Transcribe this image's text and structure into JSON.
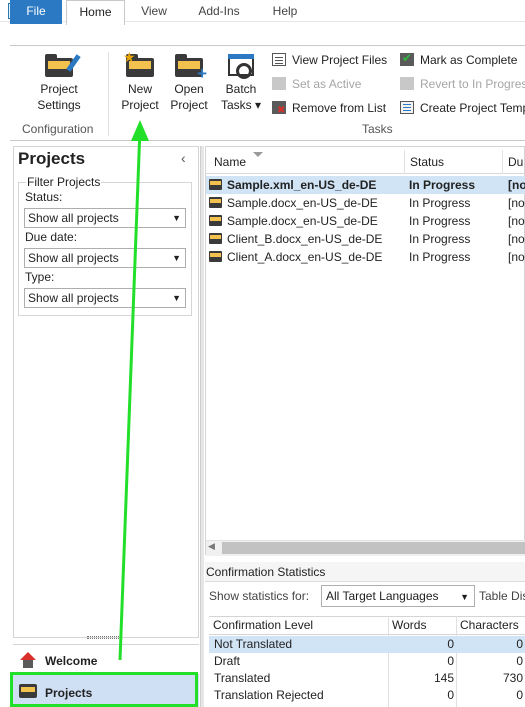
{
  "tabs": [
    {
      "label": "File"
    },
    {
      "label": "Home"
    },
    {
      "label": "View"
    },
    {
      "label": "Add-Ins"
    },
    {
      "label": "Help"
    }
  ],
  "ribbon": {
    "project_settings": {
      "line1": "Project",
      "line2": "Settings"
    },
    "configuration_label": "Configuration",
    "new_project": {
      "line1": "New",
      "line2": "Project"
    },
    "open_project": {
      "line1": "Open",
      "line2": "Project"
    },
    "batch_tasks": {
      "line1": "Batch",
      "line2": "Tasks ▾"
    },
    "view_project_files": "View Project Files",
    "set_as_active": "Set as Active",
    "remove_from_list": "Remove from List",
    "mark_as_complete": "Mark as Complete",
    "revert_to_in_progress": "Revert to In Progress",
    "create_project_template": "Create Project Template",
    "tasks_label": "Tasks"
  },
  "left_panel": {
    "title": "Projects",
    "filter_legend": "Filter Projects",
    "status_label": "Status:",
    "status_value": "Show all projects",
    "due_date_label": "Due date:",
    "due_date_value": "Show all projects",
    "type_label": "Type:",
    "type_value": "Show all projects"
  },
  "nav": {
    "welcome": "Welcome",
    "projects": "Projects"
  },
  "grid": {
    "columns": [
      "Name",
      "Status",
      "Du"
    ],
    "rows": [
      {
        "name": "Sample.xml_en-US_de-DE",
        "status": "In Progress",
        "due": "[no"
      },
      {
        "name": "Sample.docx_en-US_de-DE",
        "status": "In Progress",
        "due": "[no"
      },
      {
        "name": "Sample.docx_en-US_de-DE",
        "status": "In Progress",
        "due": "[no"
      },
      {
        "name": "Client_B.docx_en-US_de-DE",
        "status": "In Progress",
        "due": "[no"
      },
      {
        "name": "Client_A.docx_en-US_de-DE",
        "status": "In Progress",
        "due": "[no"
      }
    ]
  },
  "confirmation": {
    "title": "Confirmation Statistics",
    "show_label": "Show statistics for:",
    "target_value": "All Target Languages",
    "table_display": "Table Display",
    "columns": [
      "Confirmation Level",
      "Words",
      "Characters"
    ],
    "rows": [
      {
        "level": "Not Translated",
        "words": "0",
        "chars": "0"
      },
      {
        "level": "Draft",
        "words": "0",
        "chars": "0"
      },
      {
        "level": "Translated",
        "words": "145",
        "chars": "730"
      },
      {
        "level": "Translation Rejected",
        "words": "0",
        "chars": "0"
      }
    ]
  },
  "colors": {
    "accent": "#2b79c2",
    "highlight": "#22e02a",
    "selection": "#d1e4f5"
  }
}
